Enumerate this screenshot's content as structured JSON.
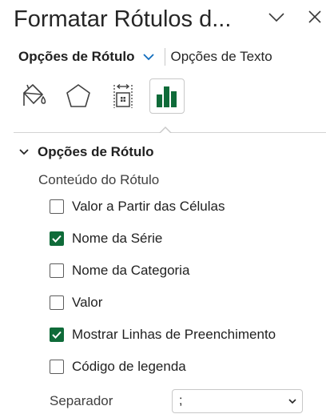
{
  "panel": {
    "title": "Formatar Rótulos d..."
  },
  "tabs": {
    "active_label": "Opções de Rótulo",
    "inactive_label": "Opções de Texto"
  },
  "section": {
    "title": "Opções de Rótulo",
    "group_label": "Conteúdo do Rótulo",
    "options": [
      {
        "label": "Valor a Partir das Células",
        "checked": false
      },
      {
        "label": "Nome da Série",
        "checked": true
      },
      {
        "label": "Nome da Categoria",
        "checked": false
      },
      {
        "label": "Valor",
        "checked": false
      },
      {
        "label": "Mostrar Linhas de Preenchimento",
        "checked": true
      },
      {
        "label": "Código de legenda",
        "checked": false
      }
    ],
    "separator": {
      "label": "Separador",
      "value": ";"
    }
  },
  "colors": {
    "accent": "#0f6b39",
    "chevron_blue": "#0f6cbd"
  }
}
